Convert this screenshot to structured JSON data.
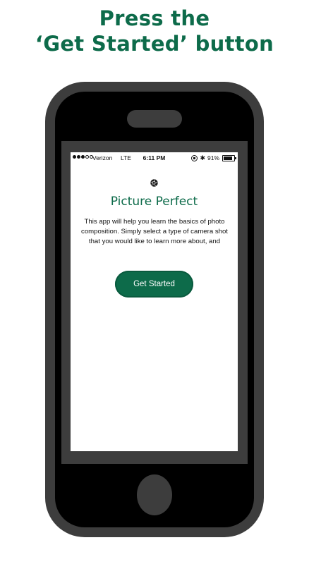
{
  "instruction": {
    "line1": "Press the",
    "line2": "‘Get Started’ button"
  },
  "status_bar": {
    "carrier": "Verizon",
    "network": "LTE",
    "time": "6:11 PM",
    "bluetooth": "✱",
    "battery": "91%"
  },
  "app": {
    "title": "Picture Perfect",
    "description": "This app will help you learn the basics of photo composition. Simply select a type of camera shot that you would like to learn more about, and",
    "get_started_label": "Get Started"
  },
  "colors": {
    "brand_green": "#0d6b4a",
    "phone_gray": "#3d3d3d"
  },
  "icons": {
    "logo": "aperture-icon",
    "home": "home-button"
  }
}
